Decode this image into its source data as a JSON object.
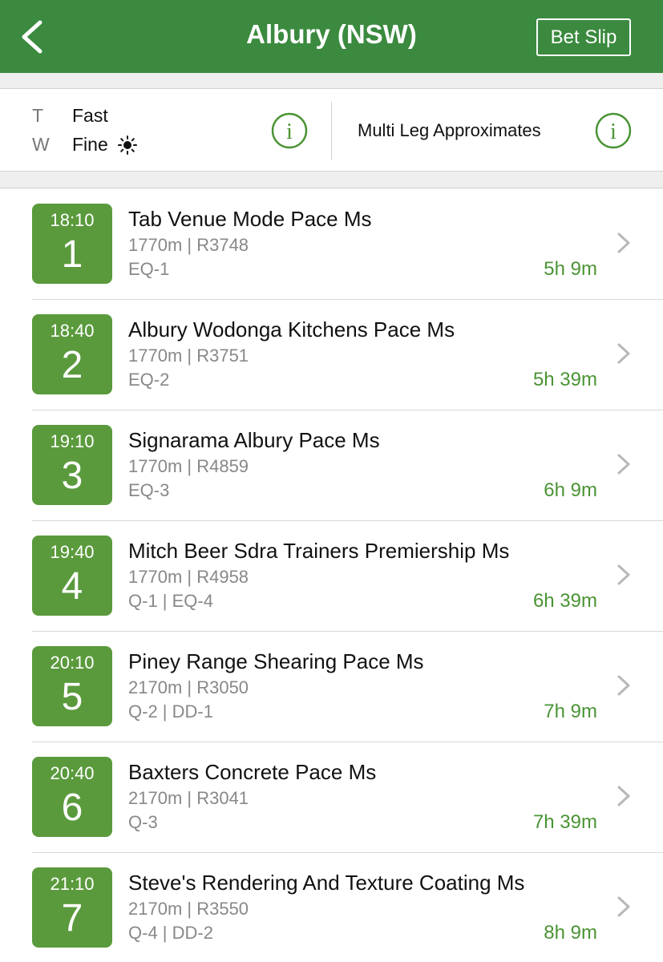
{
  "header": {
    "title": "Albury (NSW)",
    "bet_slip_label": "Bet Slip"
  },
  "conditions": {
    "track_key": "T",
    "track_value": "Fast",
    "weather_key": "W",
    "weather_value": "Fine",
    "multi_leg_label": "Multi Leg Approximates"
  },
  "races": [
    {
      "time": "18:10",
      "number": "1",
      "name": "Tab Venue Mode Pace Ms",
      "details": "1770m | R3748",
      "pools": "EQ-1",
      "countdown": "5h 9m"
    },
    {
      "time": "18:40",
      "number": "2",
      "name": "Albury Wodonga Kitchens Pace Ms",
      "details": "1770m | R3751",
      "pools": "EQ-2",
      "countdown": "5h 39m"
    },
    {
      "time": "19:10",
      "number": "3",
      "name": "Signarama Albury Pace Ms",
      "details": "1770m | R4859",
      "pools": "EQ-3",
      "countdown": "6h 9m"
    },
    {
      "time": "19:40",
      "number": "4",
      "name": "Mitch Beer Sdra Trainers Premiership Ms",
      "details": "1770m | R4958",
      "pools": "Q-1 | EQ-4",
      "countdown": "6h 39m"
    },
    {
      "time": "20:10",
      "number": "5",
      "name": "Piney Range Shearing Pace Ms",
      "details": "2170m | R3050",
      "pools": "Q-2 | DD-1",
      "countdown": "7h 9m"
    },
    {
      "time": "20:40",
      "number": "6",
      "name": "Baxters Concrete Pace Ms",
      "details": "2170m | R3041",
      "pools": "Q-3",
      "countdown": "7h 39m"
    },
    {
      "time": "21:10",
      "number": "7",
      "name": "Steve's Rendering And Texture Coating Ms",
      "details": "2170m | R3550",
      "pools": "Q-4 | DD-2",
      "countdown": "8h 9m"
    }
  ],
  "icons": {
    "back": "back-chevron-icon",
    "info": "info-icon",
    "sun": "sun-icon",
    "chevron": "chevron-right-icon"
  },
  "colors": {
    "header": "#3b8a3f",
    "badge": "#5a9a3c",
    "countdown": "#4a9434"
  }
}
